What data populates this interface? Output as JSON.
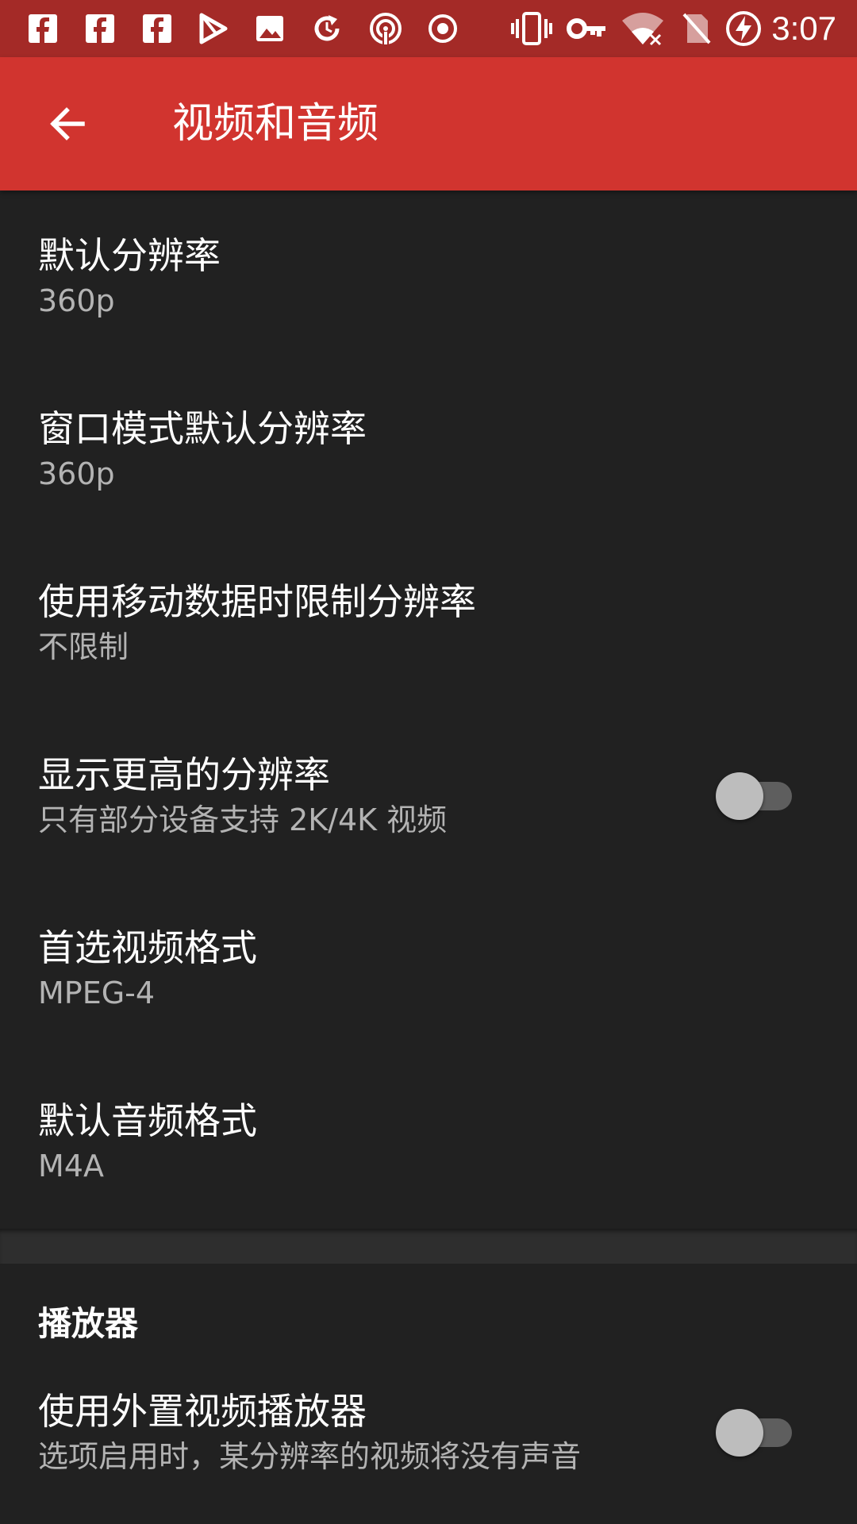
{
  "status_bar": {
    "time": "3:07",
    "icons": [
      "facebook-icon",
      "facebook-icon",
      "facebook-icon",
      "play-store-icon",
      "image-icon",
      "sync-icon",
      "cast-icon",
      "record-icon",
      "vibrate-icon",
      "vpn-key-icon",
      "wifi-off-icon",
      "no-sim-icon",
      "battery-charging-icon"
    ]
  },
  "app_bar": {
    "title": "视频和音频"
  },
  "preferences": [
    {
      "title": "默认分辨率",
      "summary": "360p"
    },
    {
      "title": "窗口模式默认分辨率",
      "summary": "360p"
    },
    {
      "title": "使用移动数据时限制分辨率",
      "summary": "不限制"
    },
    {
      "title": "显示更高的分辨率",
      "summary": "只有部分设备支持 2K/4K 视频",
      "switch": false
    },
    {
      "title": "首选视频格式",
      "summary": "MPEG-4"
    },
    {
      "title": "默认音频格式",
      "summary": "M4A"
    }
  ],
  "player_section": {
    "title": "播放器",
    "items": [
      {
        "title": "使用外置视频播放器",
        "summary": "选项启用时，某分辨率的视频将没有声音",
        "switch": false
      }
    ]
  },
  "colors": {
    "status_bar": "#a42a27",
    "app_bar": "#d1342f",
    "background": "#212121"
  }
}
